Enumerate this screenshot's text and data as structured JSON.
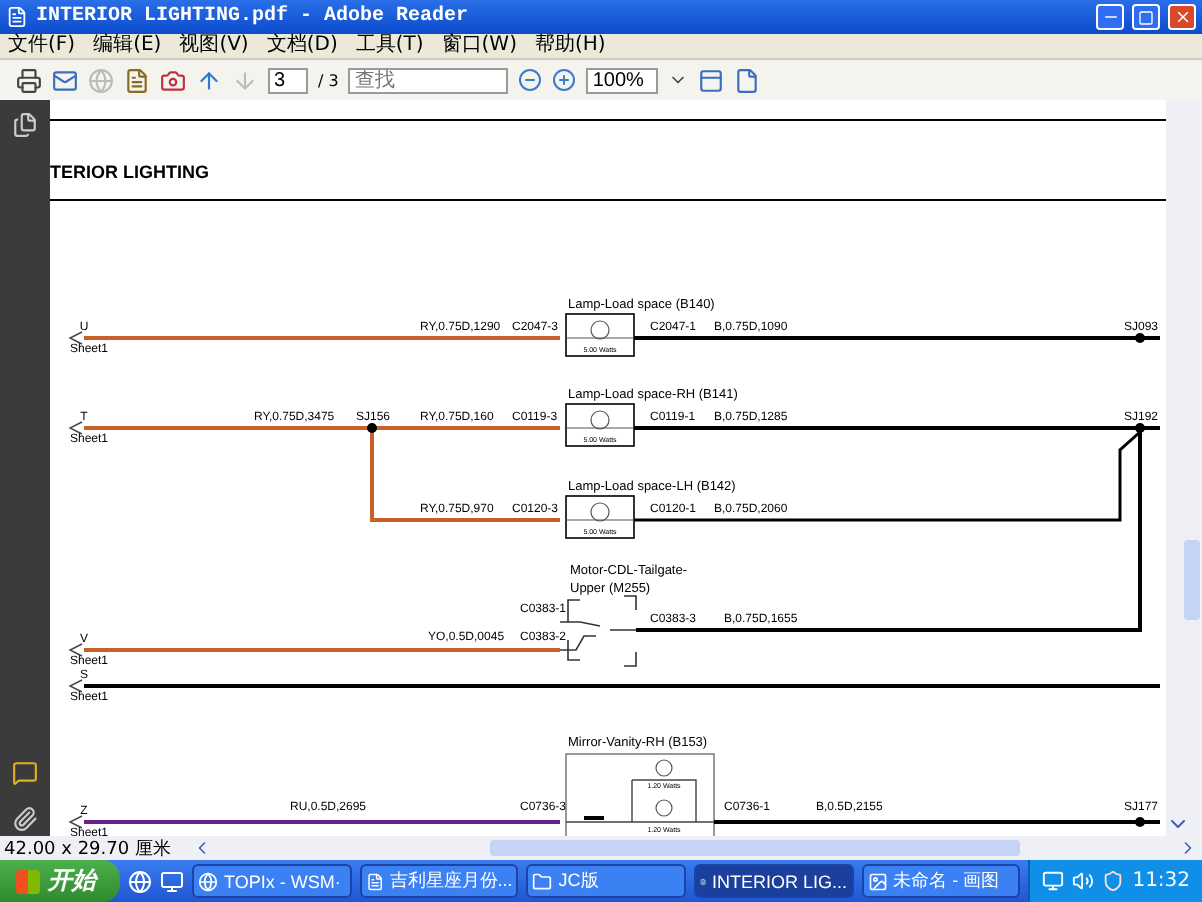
{
  "window": {
    "title": "INTERIOR LIGHTING.pdf - Adobe Reader"
  },
  "menu": [
    "文件(F)",
    "编辑(E)",
    "视图(V)",
    "文档(D)",
    "工具(T)",
    "窗口(W)",
    "帮助(H)"
  ],
  "toolbar": {
    "page": "3",
    "page_total": "/ 3",
    "search": {
      "placeholder": "查找"
    },
    "zoom": "100%"
  },
  "diagram": {
    "heading": "TERIOR LIGHTING",
    "inputs": [
      {
        "pin": "U",
        "sheet": "Sheet1",
        "color": "#c8602a"
      },
      {
        "pin": "T",
        "sheet": "Sheet1",
        "color": "#c8602a"
      },
      {
        "pin": "V",
        "sheet": "Sheet1",
        "color": "#c8602a"
      },
      {
        "pin": "S",
        "sheet": "Sheet1",
        "color": "#000000"
      },
      {
        "pin": "Z",
        "sheet": "Sheet1",
        "color": "#6a1f8a"
      }
    ],
    "feed": {
      "wire": "RY,0.75D,3475",
      "splice": "SJ156"
    },
    "lamps": [
      {
        "title": "Lamp-Load space (B140)",
        "rating": "5.00 Watts",
        "wire_in": "RY,0.75D,1290",
        "connector_in": "C2047-3",
        "connector_out": "C2047-1",
        "wire_out": "B,0.75D,1090",
        "splice": "SJ093"
      },
      {
        "title": "Lamp-Load space-RH (B141)",
        "rating": "5.00 Watts",
        "wire_in": "RY,0.75D,160",
        "connector_in": "C0119-3",
        "connector_out": "C0119-1",
        "wire_out": "B,0.75D,1285",
        "splice": "SJ192"
      },
      {
        "title": "Lamp-Load space-LH (B142)",
        "rating": "5.00 Watts",
        "wire_in": "RY,0.75D,970",
        "connector_in": "C0120-3",
        "connector_out": "C0120-1",
        "wire_out": "B,0.75D,2060"
      }
    ],
    "motor": {
      "title_lines": [
        "Motor-CDL-Tailgate-",
        "Upper (M255)"
      ],
      "connectors_in": [
        "C0383-1",
        "C0383-2"
      ],
      "wire_in": "YO,0.5D,0045",
      "connector_out": "C0383-3",
      "wire_out": "B,0.75D,1655"
    },
    "mirror": {
      "title": "Mirror-Vanity-RH (B153)",
      "ratings": [
        "1.20 Watts",
        "1.20 Watts"
      ],
      "wire_in": "RU,0.5D,2695",
      "connector_in": "C0736-3",
      "connector_out": "C0736-1",
      "wire_out": "B,0.5D,2155",
      "splice": "SJ177"
    }
  },
  "status": "42.00 x 29.70 厘米",
  "taskbar": {
    "start": "开始",
    "tasks": [
      {
        "label": "TOPIx - WSM·",
        "selected": false
      },
      {
        "label": "吉利星座月份...",
        "selected": false
      },
      {
        "label": "JC版",
        "selected": false
      },
      {
        "label": "INTERIOR LIG...",
        "selected": true
      },
      {
        "label": "未命名 - 画图",
        "selected": false
      }
    ],
    "clock": "11:32"
  }
}
